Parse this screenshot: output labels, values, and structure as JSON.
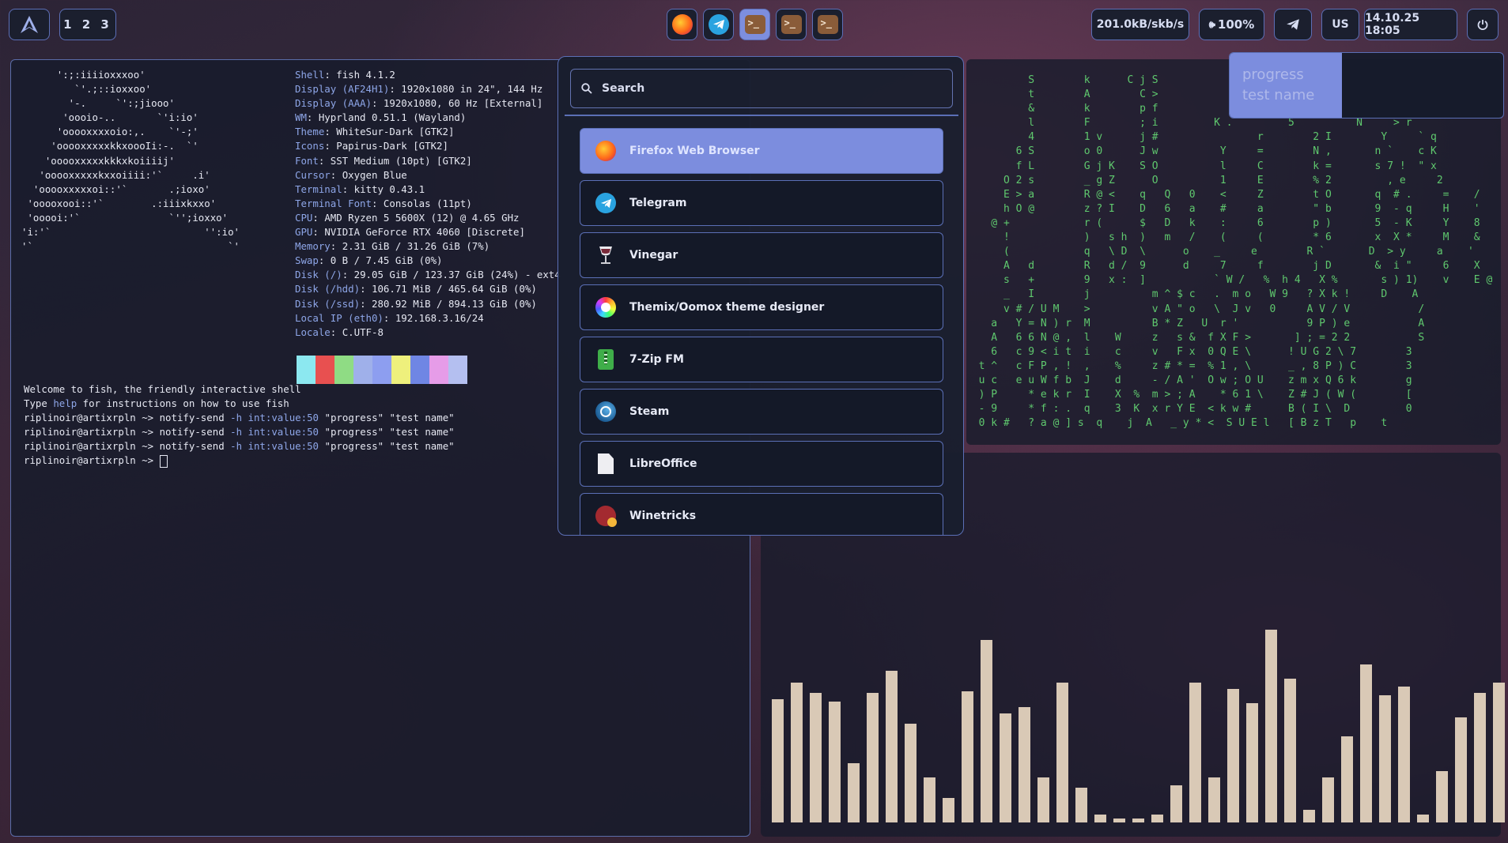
{
  "topbar": {
    "workspaces": "1 2 3",
    "apps": [
      "firefox-icon",
      "telegram-icon",
      "terminal-icon",
      "terminal-icon",
      "terminal-icon"
    ],
    "network": "201.0kB/skb/s",
    "volume": "100%",
    "keyboard_layout": "US",
    "datetime": "14.10.25 18:05"
  },
  "terminal": {
    "ascii_logo": "      ':;:iiiioxxxoo'\n         `'.;::ioxxoo'\n        '-.     `':;jiooo'\n       'oooio-..       `'i:io'\n      'ooooxxxxoio:,.    `'-;'\n     'ooooxxxxxkkxoooIi:-.  `'\n    'ooooxxxxxkkkxkoiiiij'\n   'ooooxxxxxkxxoiiii:'`     .i'\n  'ooooxxxxxoi::'`       .;ioxo'\n 'ooooxooi::'`        .:iiixkxxo'\n 'ooooi:'`               `'';ioxxo'\n'i:'`                          '':io'\n'`                                 `'",
    "sysinfo": [
      {
        "k": "Shell",
        "v": "fish 4.1.2"
      },
      {
        "k": "Display (AF24H1)",
        "v": "1920x1080 in 24\", 144 Hz"
      },
      {
        "k": "Display (AAA)",
        "v": "1920x1080, 60 Hz [External]"
      },
      {
        "k": "WM",
        "v": "Hyprland 0.51.1 (Wayland)"
      },
      {
        "k": "Theme",
        "v": "WhiteSur-Dark [GTK2]"
      },
      {
        "k": "Icons",
        "v": "Papirus-Dark [GTK2]"
      },
      {
        "k": "Font",
        "v": "SST Medium (10pt) [GTK2]"
      },
      {
        "k": "Cursor",
        "v": "Oxygen Blue"
      },
      {
        "k": "Terminal",
        "v": "kitty 0.43.1"
      },
      {
        "k": "Terminal Font",
        "v": "Consolas (11pt)"
      },
      {
        "k": "CPU",
        "v": "AMD Ryzen 5 5600X (12) @ 4.65 GHz"
      },
      {
        "k": "GPU",
        "v": "NVIDIA GeForce RTX 4060 [Discrete]"
      },
      {
        "k": "Memory",
        "v": "2.31 GiB / 31.26 GiB (7%)"
      },
      {
        "k": "Swap",
        "v": "0 B / 7.45 GiB (0%)"
      },
      {
        "k": "Disk (/)",
        "v": "29.05 GiB / 123.37 GiB (24%) - ext4"
      },
      {
        "k": "Disk (/hdd)",
        "v": "106.71 MiB / 465.64 GiB (0%)"
      },
      {
        "k": "Disk (/ssd)",
        "v": "280.92 MiB / 894.13 GiB (0%)"
      },
      {
        "k": "Local IP (eth0)",
        "v": "192.168.3.16/24"
      },
      {
        "k": "Locale",
        "v": "C.UTF-8"
      }
    ],
    "swatches": [
      "#8ce8f0",
      "#e85050",
      "#8fdc84",
      "#9fb0ea",
      "#8d9ef0",
      "#eef07c",
      "#6f86e4",
      "#e69ce8",
      "#b4bff0"
    ],
    "welcome1": "Welcome to fish, the friendly interactive shell",
    "welcome2a": "Type ",
    "welcome2b": "help",
    "welcome2c": " for instructions on how to use fish",
    "prompt": "riplinoir@artixrpln ~>",
    "cmd": "notify-send",
    "opt": "-h int:value:50",
    "args": "\"progress\" \"test name\""
  },
  "launcher": {
    "search_placeholder": "Search",
    "items": [
      "Firefox Web Browser",
      "Telegram",
      "Vinegar",
      "Themix/Oomox theme designer",
      "7-Zip FM",
      "Steam",
      "LibreOffice",
      "Winetricks"
    ]
  },
  "notification": {
    "title": "progress",
    "body": "test name",
    "progress": 0.41
  },
  "matrix": {
    "text": "          S        k      C j S\n          t        A        C >\n          &        k        p f\n          l        F        ; i         K .         5          N     > r\n          4        1 v      j #                r        2 I        Y     ` q\n        6 S        o 0      J w          Y     =        N ,       n `    c K\n        f L        G j K    S O          l     C        k =       s 7 !  \" x\n      O 2 s        _ g Z      O          1     E        % 2         , e     2\n      E > a        R @ <    q   Q   0    <     Z        t O       q  # .     =    /\n      h O @        z ? I    D   6   a    #     a        \" b       9  - q     H    '\n    @ +            r (      $   D   k    :     6        p )       5  - K     Y    8\n      !            )   s h  )   m   /    (     (        * 6       x  X *     M    &\n      (            q   \\ D  \\      o    _     e        R `       D  > y     a    '\n      A   d        R   d /  9      d     7     f        j D       &  i \"     6    X\n      s   +        9   x :  ]           ` W /   %  h 4   X %       s ) 1)    v    E @\n      _   I        j          m ^ $ c   .  m o   W 9   ? X k !     D    A\n      v # / U M    >          v A \" o   \\  J v   0     A V / V           /\n    a   Y = N ) r  M          B * Z   U  r '           9 P ) e           A\n    A   6 6 N @ ,  l    W     z   s &  f X F >       ] ; = 2 2           S\n    6   c 9 < i t  i    c     v   F x  0 Q E \\      ! U G 2 \\ 7        3\n  t ^   c F P , !  ,    %     z # * =  % 1 , \\      _ , 8 P ) C        3\n  u c   e u W f b  J    d     - / A '  O w ; O U    z m x Q 6 k        g\n  ) P     * e k r  I    X  %  m > ; A    * 6 1 \\    Z # J ( W (        [\n  - 9     * f : .  q    3  K  x r Y E  < k w #      B ( I \\  D         0\n  0 k #   ? a @ ] s  q    j  A   _ y * <  S U E l   [ B z T   p    t"
  },
  "visualizer": [
    60,
    68,
    63,
    59,
    29,
    63,
    74,
    48,
    22,
    12,
    64,
    89,
    53,
    56,
    22,
    68,
    17,
    4,
    2,
    2,
    4,
    18,
    68,
    22,
    65,
    58,
    94,
    70,
    6,
    22,
    42,
    77,
    62,
    66,
    4,
    25,
    51,
    63,
    68,
    62
  ]
}
